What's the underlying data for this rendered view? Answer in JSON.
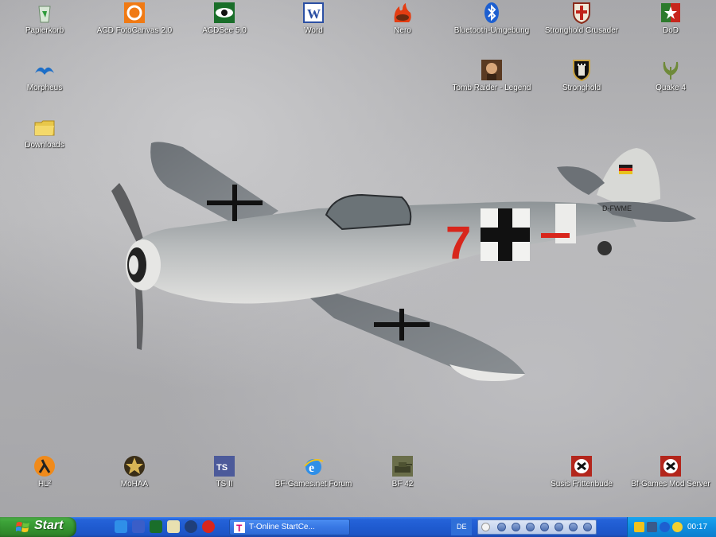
{
  "desktop": {
    "icons": [
      {
        "label": "Papierkorb",
        "icon": "recycle-bin-icon"
      },
      {
        "label": "ACD FotoCanvas 2.0",
        "icon": "acd-fotocanvas-icon"
      },
      {
        "label": "ACDSee 5.0",
        "icon": "acdsee-eye-icon"
      },
      {
        "label": "Word",
        "icon": "word-icon"
      },
      {
        "label": "Nero",
        "icon": "nero-flame-icon"
      },
      {
        "label": "Bluetooth-Umgebung",
        "icon": "bluetooth-icon"
      },
      {
        "label": "Stronghold Crusader",
        "icon": "stronghold-crusader-shield-icon"
      },
      {
        "label": "DoD",
        "icon": "dod-icon"
      },
      {
        "label": "Morpheus",
        "icon": "morpheus-icon"
      },
      {
        "label": "Tomb Raider - Legend",
        "icon": "tomb-raider-icon"
      },
      {
        "label": "Stronghold",
        "icon": "stronghold-shield-icon"
      },
      {
        "label": "Quake 4",
        "icon": "quake-icon"
      },
      {
        "label": "Downloads",
        "icon": "folder-icon"
      },
      {
        "label": "HL²",
        "icon": "half-life-lambda-icon"
      },
      {
        "label": "MoHAA",
        "icon": "mohaa-medal-icon"
      },
      {
        "label": "TS II",
        "icon": "teamspeak-icon"
      },
      {
        "label": "BF-Games.net Forum",
        "icon": "internet-explorer-icon"
      },
      {
        "label": "BF 42",
        "icon": "bf42-tank-icon"
      },
      {
        "label": "Susis Frittenbude",
        "icon": "susis-frittenbude-icon"
      },
      {
        "label": "Bf-Games Mod Server",
        "icon": "bf-games-mod-server-icon"
      }
    ]
  },
  "wallpaper": {
    "aircraft_marking": "7",
    "registration": "D-FWME"
  },
  "taskbar": {
    "start_label": "Start",
    "quick_launch": [
      "ie-quicklaunch-icon",
      "messenger-icon",
      "acdsee-quick-icon",
      "outlook-icon",
      "media-player-icon",
      "skype-icon"
    ],
    "window_button_label": "T-Online StartCe...",
    "language": "DE",
    "clock": "00:17",
    "colors": {
      "taskbar": "#245edb",
      "start": "#3c9f38",
      "tray": "#0f8ee0"
    }
  }
}
